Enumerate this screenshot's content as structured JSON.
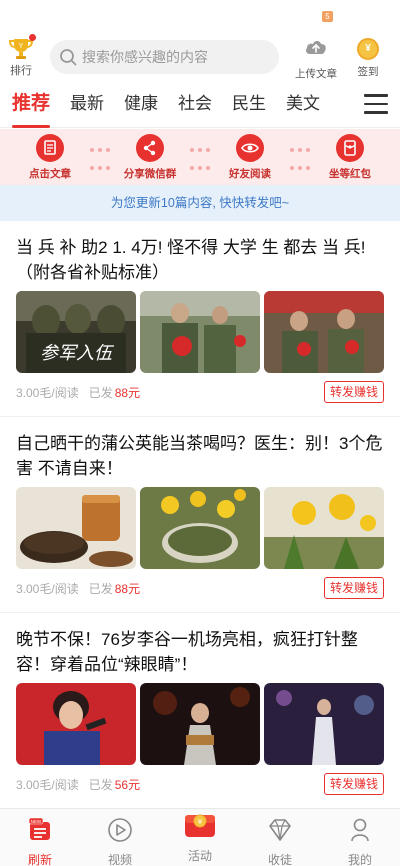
{
  "header": {
    "rank_label": "排行",
    "search_placeholder": "搜索你感兴趣的内容",
    "upload_label": "上传文章",
    "notify_badge": "5",
    "signin_label": "签到",
    "signin_coin": "¥"
  },
  "tabs": [
    {
      "label": "推荐"
    },
    {
      "label": "最新"
    },
    {
      "label": "健康"
    },
    {
      "label": "社会"
    },
    {
      "label": "民生"
    },
    {
      "label": "美文"
    }
  ],
  "guide": {
    "steps": [
      {
        "label": "点击文章",
        "icon": "document-icon"
      },
      {
        "label": "分享微信群",
        "icon": "share-icon"
      },
      {
        "label": "好友阅读",
        "icon": "eye-icon"
      },
      {
        "label": "坐等红包",
        "icon": "red-packet-icon"
      }
    ]
  },
  "update_banner": "为您更新10篇内容, 快快转发吧~",
  "articles": [
    {
      "title": "当 兵 补 助2 1. 4万! 怪不得 大学 生 都去 当 兵! （附各省补贴标准）",
      "price": "3.00毛/阅读",
      "sent_prefix": "已发",
      "sent_value": "88元",
      "share_label": "转发赚钱",
      "image_caption": "参军入伍"
    },
    {
      "title": "自己晒干的蒲公英能当茶喝吗？医生：别！3个危害 不请自来！",
      "price": "3.00毛/阅读",
      "sent_prefix": "已发",
      "sent_value": "88元",
      "share_label": "转发赚钱"
    },
    {
      "title": "晚节不保！76岁李谷一机场亮相，疯狂打针整容！穿着品位“辣眼睛”！",
      "price": "3.00毛/阅读",
      "sent_prefix": "已发",
      "sent_value": "56元",
      "share_label": "转发赚钱"
    }
  ],
  "bottom_nav": [
    {
      "label": "刷新",
      "icon": "refresh-icon",
      "badge": "NEW"
    },
    {
      "label": "视频",
      "icon": "play-icon"
    },
    {
      "label": "活动",
      "icon": "gift-icon"
    },
    {
      "label": "收徒",
      "icon": "diamond-icon"
    },
    {
      "label": "我的",
      "icon": "profile-icon"
    }
  ],
  "colors": {
    "accent": "#e8322f",
    "banner_bg": "#e6f0fb",
    "banner_text": "#3d79c6",
    "guide_bg": "#fdeaea"
  }
}
